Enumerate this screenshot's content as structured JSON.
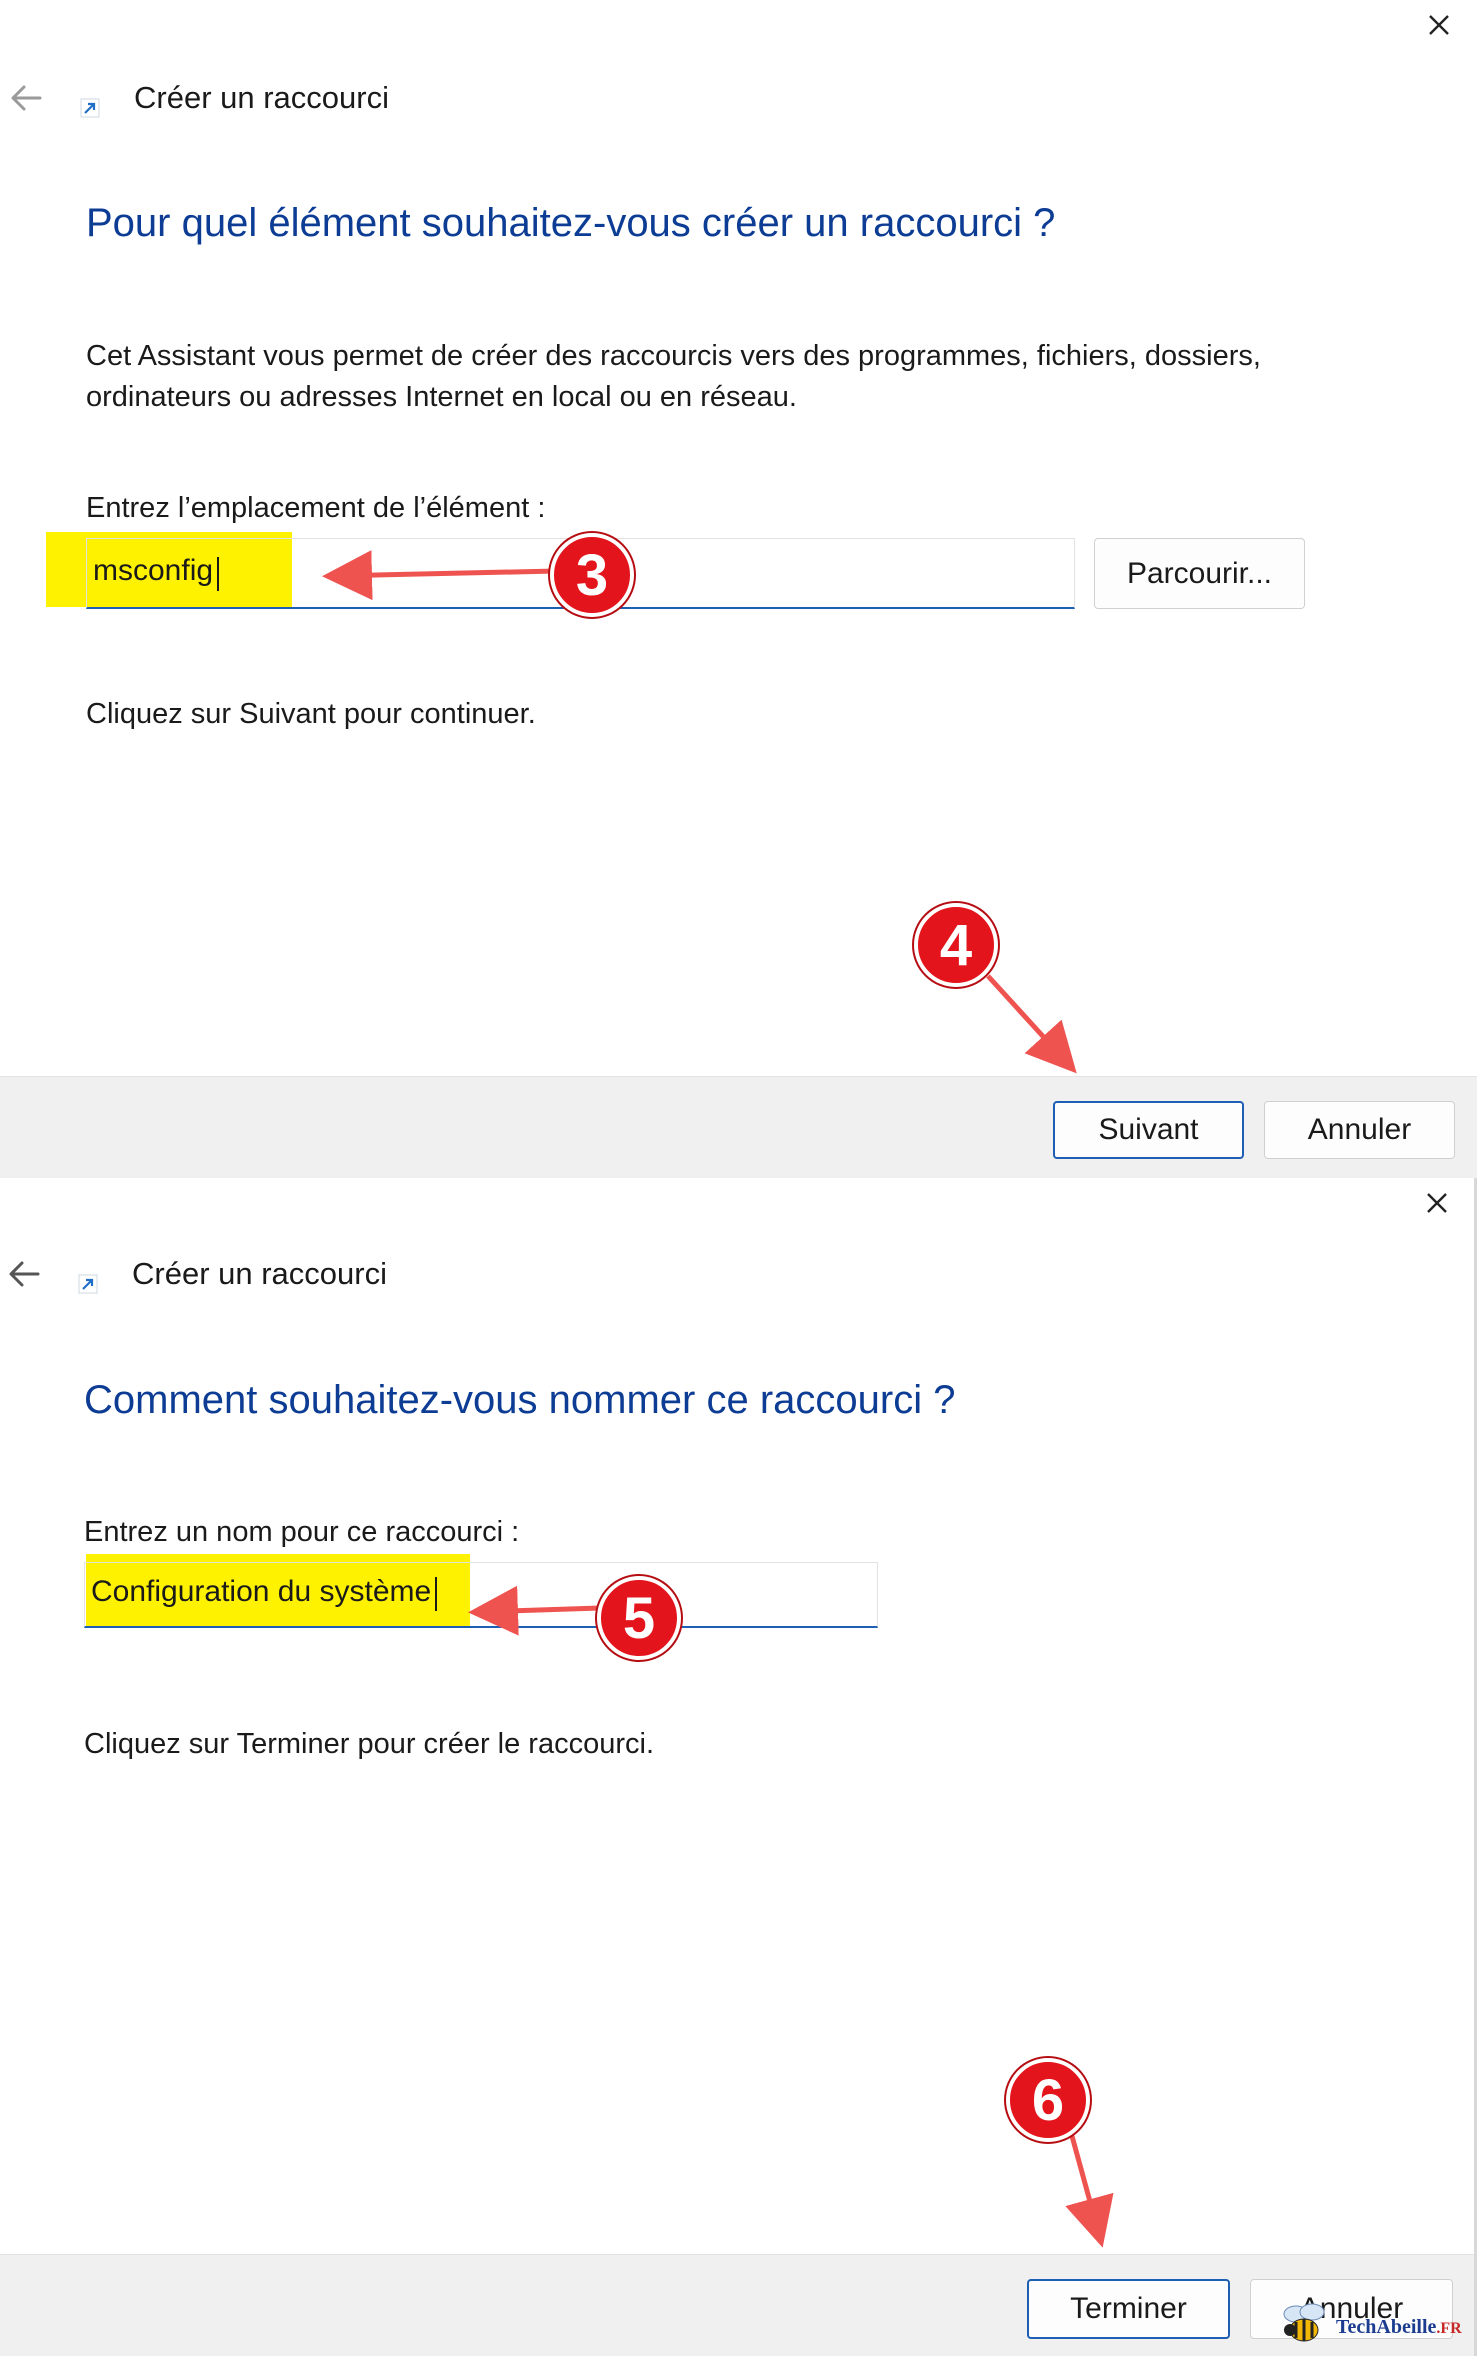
{
  "dialog1": {
    "wizard_title": "Créer un raccourci",
    "heading": "Pour quel élément souhaitez-vous créer un raccourci ?",
    "description": "Cet Assistant vous permet de créer des raccourcis vers des programmes, fichiers, dossiers, ordinateurs ou adresses Internet en local ou en réseau.",
    "location_label": "Entrez l’emplacement de l’élément :",
    "location_value": "msconfig",
    "browse_label": "Parcourir...",
    "hint": "Cliquez sur Suivant pour continuer.",
    "next_label": "Suivant",
    "cancel_label": "Annuler"
  },
  "dialog2": {
    "wizard_title": "Créer un raccourci",
    "heading": "Comment souhaitez-vous nommer ce raccourci ?",
    "name_label": "Entrez un nom pour ce raccourci :",
    "name_value": "Configuration du système",
    "hint": "Cliquez sur Terminer pour créer le raccourci.",
    "finish_label": "Terminer",
    "cancel_label": "Annuler"
  },
  "annotations": {
    "step3": "3",
    "step4": "4",
    "step5": "5",
    "step6": "6",
    "badge_color": "#e3141b",
    "arrow_color": "#ef5350",
    "highlight_color": "#fff200"
  },
  "watermark": {
    "brand": "TechAbeille",
    "tld": ".FR"
  },
  "colors": {
    "heading": "#0c3c94",
    "accent": "#1f5fb3",
    "footer": "#f0f0f0"
  }
}
